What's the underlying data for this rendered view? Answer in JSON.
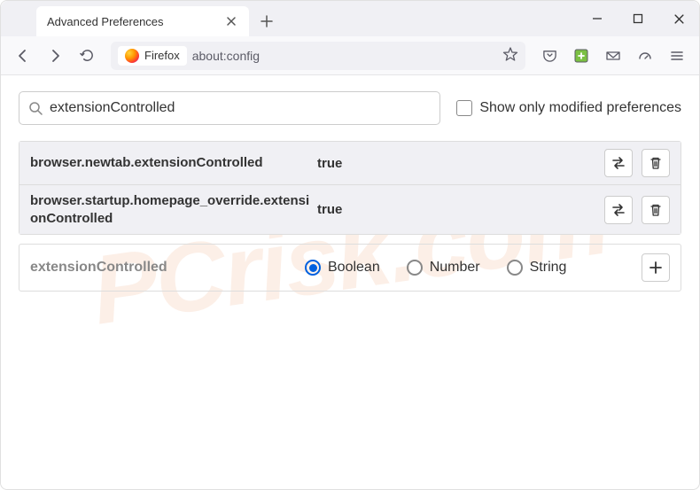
{
  "tab": {
    "title": "Advanced Preferences"
  },
  "urlbar": {
    "badge_label": "Firefox",
    "url": "about:config"
  },
  "search": {
    "value": "extensionControlled",
    "modified_only_label": "Show only modified preferences"
  },
  "prefs": [
    {
      "name": "browser.newtab.extensionControlled",
      "value": "true"
    },
    {
      "name": "browser.startup.homepage_override.extensionControlled",
      "value": "true"
    }
  ],
  "new_pref": {
    "name": "extensionControlled",
    "types": {
      "boolean": "Boolean",
      "number": "Number",
      "string": "String"
    }
  },
  "watermark": "PCrisk.com"
}
